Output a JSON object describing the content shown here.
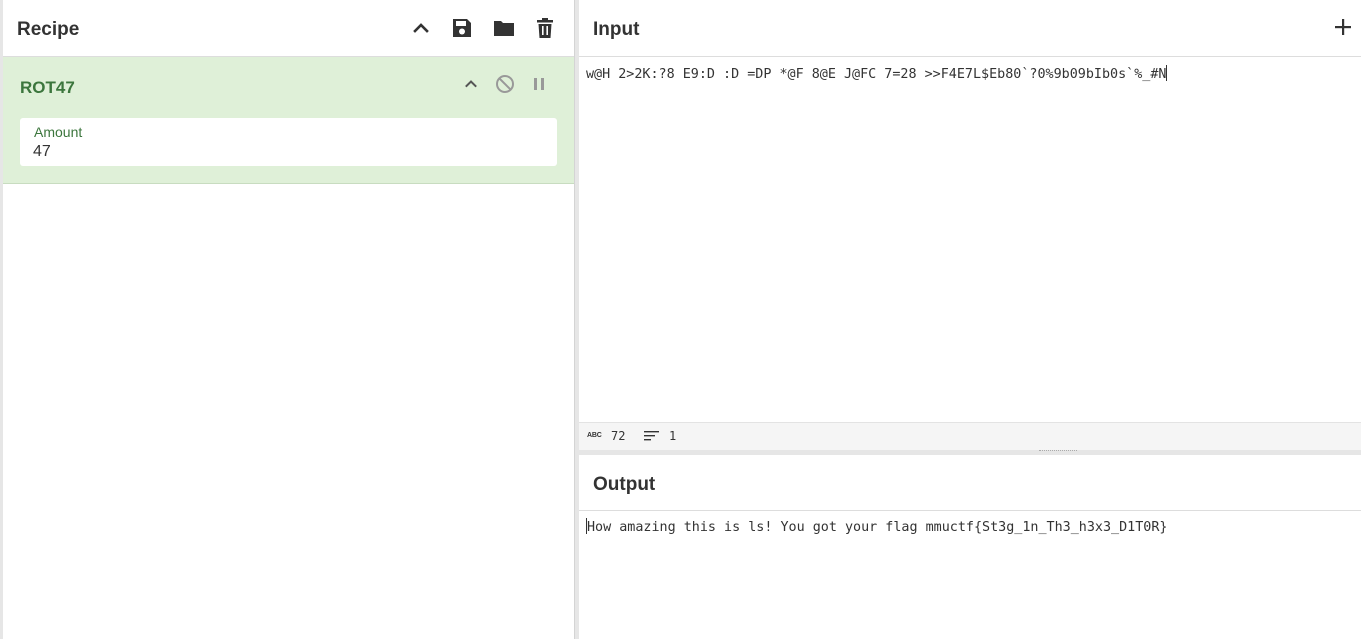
{
  "recipe": {
    "title": "Recipe",
    "icons": [
      "chevron-up-icon",
      "save-icon",
      "folder-icon",
      "trash-icon"
    ],
    "operations": [
      {
        "name": "ROT47",
        "icons": [
          "chevron-up-icon",
          "disable-icon",
          "pause-icon"
        ],
        "args": [
          {
            "label": "Amount",
            "value": "47"
          }
        ]
      }
    ]
  },
  "input": {
    "title": "Input",
    "add_icon": "plus-icon",
    "text": "w@H 2>2K:?8 E9:D :D =DP *@F 8@E J@FC 7=28 >>F4E7L$Eb80`?0%9b09bIb0s`%_#N",
    "status": {
      "abc_label": "ABC",
      "char_count": "72",
      "line_count": "1"
    }
  },
  "output": {
    "title": "Output",
    "text": "How amazing this is ls! You got your flag mmuctf{St3g_1n_Th3_h3x3_D1T0R}"
  },
  "colors": {
    "op_background": "#dff0d8",
    "op_text": "#3c763d",
    "divider": "#e6e6e6"
  }
}
